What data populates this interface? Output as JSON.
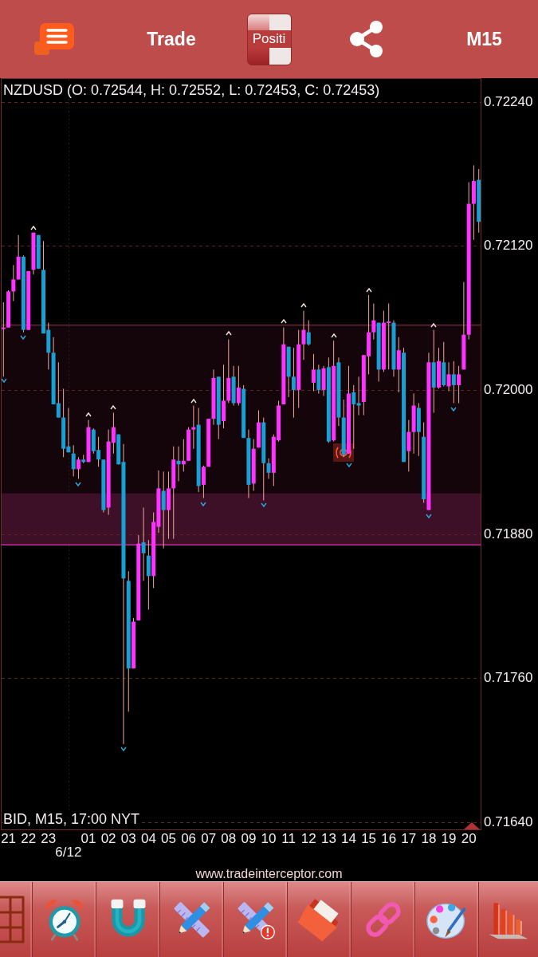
{
  "header": {
    "trade_label": "Trade",
    "toggle_label": "Positi",
    "timeframe": "M15"
  },
  "chart": {
    "symbol_info": "NZDUSD (O: 0.72544, H: 0.72552, L: 0.72453, C: 0.72453)",
    "quote_info": "BID, M15, 17:00 NYT",
    "chart_data": {
      "type": "candlestick",
      "categories": [
        null,
        "21",
        null,
        null,
        null,
        "22",
        null,
        null,
        null,
        "23",
        null,
        null,
        null,
        null,
        null,
        null,
        null,
        "01",
        null,
        null,
        null,
        "02",
        null,
        null,
        null,
        "03",
        null,
        null,
        null,
        "04",
        null,
        null,
        null,
        "05",
        null,
        null,
        null,
        "06",
        null,
        null,
        null,
        "07",
        null,
        null,
        null,
        "08",
        null,
        null,
        null,
        "09",
        null,
        null,
        null,
        "10",
        null,
        null,
        null,
        "11",
        null,
        null,
        null,
        "12",
        null,
        null,
        null,
        "13",
        null,
        null,
        null,
        "14",
        null,
        null,
        null,
        "15",
        null,
        null,
        null,
        "16",
        null,
        null,
        null,
        "17",
        null,
        null,
        null,
        "18",
        null,
        null,
        null,
        "19",
        null,
        null,
        null,
        "20",
        null,
        null
      ],
      "ohlc": [
        [
          0.72051,
          0.72073,
          0.72011,
          0.72052
        ],
        [
          0.72052,
          0.72083,
          0.72052,
          0.72082
        ],
        [
          0.72082,
          0.72104,
          0.72074,
          0.72092
        ],
        [
          0.72092,
          0.72129,
          0.72092,
          0.72111
        ],
        [
          0.72111,
          0.72112,
          0.72048,
          0.7205
        ],
        [
          0.7205,
          0.72099,
          0.7205,
          0.72099
        ],
        [
          0.721,
          0.72131,
          0.72096,
          0.72131
        ],
        [
          0.72129,
          0.72129,
          0.72101,
          0.72101
        ],
        [
          0.721,
          0.72124,
          0.72047,
          0.72047
        ],
        [
          0.7205,
          0.72056,
          0.72017,
          0.72031
        ],
        [
          0.72031,
          0.72044,
          0.71988,
          0.71988
        ],
        [
          0.71989,
          0.72023,
          0.71977,
          0.71977
        ],
        [
          0.71977,
          0.72001,
          0.71944,
          0.71951
        ],
        [
          0.71953,
          0.71985,
          0.71948,
          0.71948
        ],
        [
          0.71947,
          0.71954,
          0.71928,
          0.71934
        ],
        [
          0.71934,
          0.71944,
          0.71926,
          0.71942
        ],
        [
          0.71942,
          0.71946,
          0.71939,
          0.7194
        ],
        [
          0.7194,
          0.71975,
          0.7194,
          0.71969
        ],
        [
          0.71967,
          0.71968,
          0.71947,
          0.71949
        ],
        [
          0.7195,
          0.71961,
          0.71936,
          0.71942
        ],
        [
          0.71942,
          0.71942,
          0.71898,
          0.719
        ],
        [
          0.71902,
          0.71967,
          0.71896,
          0.71957
        ],
        [
          0.71956,
          0.71981,
          0.71947,
          0.71969
        ],
        [
          0.71963,
          0.71963,
          0.71938,
          0.71938
        ],
        [
          0.7194,
          0.71955,
          0.71705,
          0.71843
        ],
        [
          0.71841,
          0.71849,
          0.71732,
          0.71768
        ],
        [
          0.71768,
          0.7181,
          0.71768,
          0.71807
        ],
        [
          0.71808,
          0.71879,
          0.71808,
          0.71872
        ],
        [
          0.71873,
          0.71902,
          0.71841,
          0.71864
        ],
        [
          0.71862,
          0.71875,
          0.71817,
          0.71845
        ],
        [
          0.71845,
          0.71898,
          0.71835,
          0.7189
        ],
        [
          0.71886,
          0.71933,
          0.71881,
          0.71918
        ],
        [
          0.71916,
          0.71932,
          0.71868,
          0.719
        ],
        [
          0.719,
          0.71932,
          0.71876,
          0.71918
        ],
        [
          0.71918,
          0.71953,
          0.71876,
          0.71942
        ],
        [
          0.71941,
          0.71953,
          0.71924,
          0.71938
        ],
        [
          0.71938,
          0.71959,
          0.71932,
          0.71941
        ],
        [
          0.71941,
          0.71969,
          0.71941,
          0.71967
        ],
        [
          0.71967,
          0.71987,
          0.71951,
          0.71969
        ],
        [
          0.71971,
          0.71985,
          0.71915,
          0.7192
        ],
        [
          0.71921,
          0.71937,
          0.7191,
          0.71936
        ],
        [
          0.71936,
          0.71976,
          0.71936,
          0.71976
        ],
        [
          0.71976,
          0.72017,
          0.71971,
          0.7201
        ],
        [
          0.72011,
          0.72011,
          0.71959,
          0.71971
        ],
        [
          0.71974,
          0.72021,
          0.71968,
          0.71991
        ],
        [
          0.71991,
          0.72042,
          0.71989,
          0.7201
        ],
        [
          0.72011,
          0.7202,
          0.71987,
          0.71989
        ],
        [
          0.71989,
          0.7202,
          0.71987,
          0.72002
        ],
        [
          0.72001,
          0.72004,
          0.7196,
          0.7196
        ],
        [
          0.7196,
          0.71967,
          0.7191,
          0.71921
        ],
        [
          0.71922,
          0.71959,
          0.71916,
          0.71951
        ],
        [
          0.71952,
          0.71983,
          0.71952,
          0.71973
        ],
        [
          0.71973,
          0.71977,
          0.71908,
          0.71939
        ],
        [
          0.71939,
          0.71943,
          0.71926,
          0.71931
        ],
        [
          0.71931,
          0.71963,
          0.7192,
          0.71961
        ],
        [
          0.71958,
          0.71991,
          0.71957,
          0.71987
        ],
        [
          0.71988,
          0.72052,
          0.71988,
          0.72038
        ],
        [
          0.72036,
          0.72036,
          0.71994,
          0.72011
        ],
        [
          0.72011,
          0.72035,
          0.71977,
          0.72
        ],
        [
          0.72,
          0.7205,
          0.71985,
          0.72038
        ],
        [
          0.72038,
          0.72066,
          0.72025,
          0.7205
        ],
        [
          0.72048,
          0.72058,
          0.72037,
          0.72038
        ],
        [
          0.72006,
          0.7203,
          0.71999,
          0.72017
        ],
        [
          0.72017,
          0.72021,
          0.71997,
          0.72
        ],
        [
          0.72,
          0.7202,
          0.71995,
          0.72018
        ],
        [
          0.72019,
          0.72027,
          0.71956,
          0.71957
        ],
        [
          0.71958,
          0.72041,
          0.71957,
          0.7202
        ],
        [
          0.72023,
          0.72027,
          0.7197,
          0.71977
        ],
        [
          0.71977,
          0.71992,
          0.71944,
          0.71946
        ],
        [
          0.71947,
          0.7202,
          0.71947,
          0.71997
        ],
        [
          0.71998,
          0.72004,
          0.71951,
          0.71988
        ],
        [
          0.71989,
          0.72011,
          0.71979,
          0.71987
        ],
        [
          0.7199,
          0.72029,
          0.71979,
          0.72029
        ],
        [
          0.72028,
          0.72079,
          0.72013,
          0.72048
        ],
        [
          0.72048,
          0.72072,
          0.72042,
          0.72058
        ],
        [
          0.72056,
          0.72056,
          0.72007,
          0.72017
        ],
        [
          0.72017,
          0.72066,
          0.72015,
          0.72056
        ],
        [
          0.72056,
          0.72072,
          0.72017,
          0.72057
        ],
        [
          0.72056,
          0.72058,
          0.72011,
          0.72017
        ],
        [
          0.72017,
          0.72044,
          0.71998,
          0.72033
        ],
        [
          0.72031,
          0.72035,
          0.7194,
          0.7194
        ],
        [
          0.71949,
          0.71975,
          0.71932,
          0.71965
        ],
        [
          0.71965,
          0.71997,
          0.71947,
          0.71987
        ],
        [
          0.71985,
          0.71989,
          0.71945,
          0.71965
        ],
        [
          0.71961,
          0.71973,
          0.71906,
          0.71909
        ],
        [
          0.719,
          0.72031,
          0.719,
          0.72023
        ],
        [
          0.72023,
          0.7205,
          0.71981,
          0.72002
        ],
        [
          0.72002,
          0.72035,
          0.72001,
          0.72024
        ],
        [
          0.72023,
          0.7204,
          0.72003,
          0.72004
        ],
        [
          0.72003,
          0.72023,
          0.71999,
          0.72013
        ],
        [
          0.72013,
          0.72024,
          0.71989,
          0.72004
        ],
        [
          0.72004,
          0.7202,
          0.71989,
          0.72013
        ],
        [
          0.72017,
          0.7209,
          0.72017,
          0.72046
        ],
        [
          0.72046,
          0.72173,
          0.72042,
          0.72155
        ],
        [
          0.72155,
          0.72187,
          0.72125,
          0.72174
        ],
        [
          0.72175,
          0.72184,
          0.72131,
          0.7214
        ]
      ],
      "ylim": [
        0.71634,
        0.72259
      ],
      "yticks": [
        {
          "value": 0.7224,
          "label": "0.72240"
        },
        {
          "value": 0.7212,
          "label": "0.72120"
        },
        {
          "value": 0.72,
          "label": "0.72000"
        },
        {
          "value": 0.7188,
          "label": "0.71880"
        },
        {
          "value": 0.7176,
          "label": "0.71760"
        },
        {
          "value": 0.7164,
          "label": "0.71640"
        }
      ],
      "grid": true,
      "bands": [
        {
          "axis": "y",
          "from": 0.71914,
          "to": 0.72054,
          "color": "#14050b"
        },
        {
          "axis": "y",
          "from": 0.71871,
          "to": 0.71914,
          "color": "#3d1028"
        }
      ],
      "ref_lines": [
        {
          "axis": "y",
          "value": 0.72054,
          "color": "#62283a"
        },
        {
          "axis": "y",
          "value": 0.71871,
          "color": "#c42ca0"
        }
      ]
    },
    "date_label": "6/12"
  },
  "website": "www.tradeinterceptor.com",
  "toolbar": [
    {
      "kind": "grid",
      "alert": false
    },
    {
      "kind": "alarm",
      "alert": false
    },
    {
      "kind": "magnet",
      "alert": false
    },
    {
      "kind": "drawing-tools",
      "alert": false
    },
    {
      "kind": "drawing-tools",
      "alert": true
    },
    {
      "kind": "folder",
      "alert": false
    },
    {
      "kind": "link",
      "alert": false
    },
    {
      "kind": "palette",
      "alert": false
    },
    {
      "kind": "indicators",
      "alert": false
    }
  ]
}
